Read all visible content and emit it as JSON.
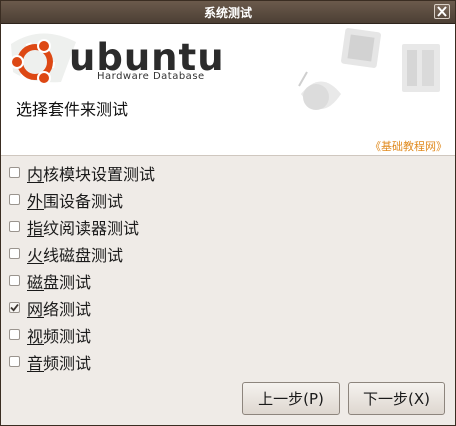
{
  "window": {
    "title": "系统测试",
    "close_icon": "close-icon"
  },
  "header": {
    "brand": "ubuntu",
    "brand_subtitle": "Hardware Database",
    "title": "选择套件来测试",
    "watermark": "《基础教程网》"
  },
  "options": [
    {
      "label": "内核模块设置测试",
      "checked": false
    },
    {
      "label": "外围设备测试",
      "checked": false
    },
    {
      "label": "指纹阅读器测试",
      "checked": false
    },
    {
      "label": "火线磁盘测试",
      "checked": false
    },
    {
      "label": "磁盘测试",
      "checked": false
    },
    {
      "label": "网络测试",
      "checked": true
    },
    {
      "label": "视频测试",
      "checked": false
    },
    {
      "label": "音频测试",
      "checked": false
    }
  ],
  "buttons": {
    "prev": "上一步(P)",
    "next": "下一步(X)"
  },
  "colors": {
    "titlebar": "#5a4a3d",
    "ubuntu_orange": "#dd4814",
    "watermark": "#e08a1e"
  }
}
